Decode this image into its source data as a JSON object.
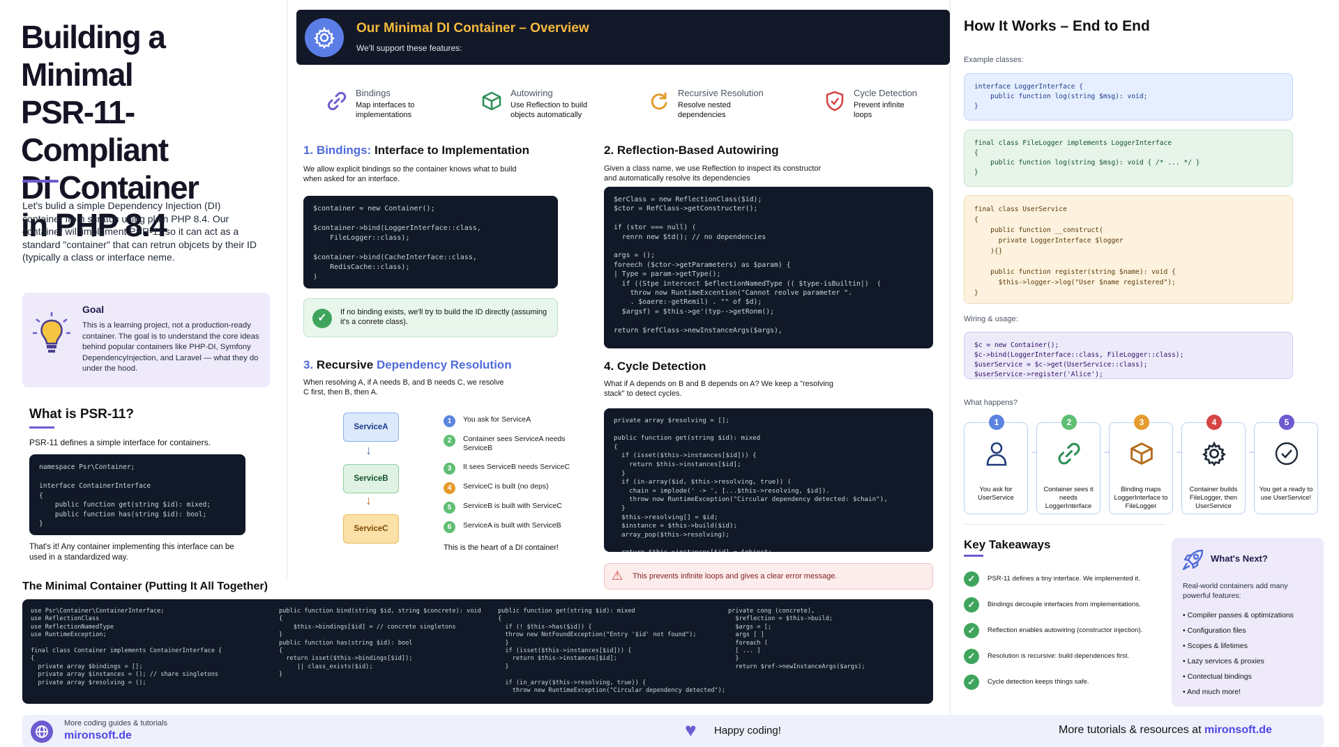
{
  "left": {
    "title_lines": [
      "Building a Minimal",
      "PSR-11-Compliant",
      "DI Container",
      "in PHP 8.4"
    ],
    "intro": "Let's bulid a simple Dependency Injection (DI) container from scratch using plain PHP 8.4. Our container will implement PSR-11 so it can act as a standard \"container\" that can retrun objcets by their ID (typically a class or interface neme.",
    "goal_title": "Goal",
    "goal_text": "This is a learning project, not a production-ready container. The goal is to understand the core ideas behind popular containers like PHP-DI, Symfony DependencyInjection, and Laravel — what they do under the hood.",
    "psr_title": "What is PSR-11?",
    "psr_text": "PSR-11 defines a simple interface for containers.",
    "psr_code": "namespace Psr\\Container;\n\ninterface ContainerInterface\n{\n    public function get(string $id): mixed;\n    public function has(string $id): bool;\n}",
    "psr_footer": "That's it! Any container implementing this interface can be used in a standardized way."
  },
  "overview": {
    "title": "Our Minimal DI Container – Overview",
    "subtitle": "We'll support these features:",
    "features": [
      {
        "name": "Bindings",
        "desc": "Map interfaces to implementations",
        "icon": "link-icon"
      },
      {
        "name": "Autowiring",
        "desc": "Use Reflection to build objects automatically",
        "icon": "cube-icon"
      },
      {
        "name": "Recursive Resolution",
        "desc": "Resolve nested dependencies",
        "icon": "refresh-icon"
      },
      {
        "name": "Cycle Detection",
        "desc": "Prevent infinite loops",
        "icon": "shield-icon"
      }
    ]
  },
  "s1": {
    "num": "1.",
    "hl": "Bindings:",
    "title": "Interface to Implementation",
    "desc": "We allow explicit bindings so the container knows what to build when asked for an interface.",
    "code": "$container = new Container();\n\n$container->bind(LoggerInterface::class,\n    FileLogger::class);\n\n$container->bind(CacheInterface::class,\n    RedisCache::class);\n)",
    "note": "If no binding exists, we'll try to build the ID directly (assuming it's a conrete class)."
  },
  "s2": {
    "title": "2. Reflection-Based Autowiring",
    "desc": "Given a class name, we use Reflection to inspect its constructor and automatically resolve its dependencies",
    "code": "$erClass = new ReflectionClass($id);\n$ctor = RefClass->getConstructer();\n\nif (stor === null) (\n  renrn new $td(); // no dependencies\n\nargs = ();\nforeech ($ctor->getParameters) as $param) {\n| Type = param->getType();\n  if ((Stpe intercect $eflectionNamedType (( $type-isBuiltin|)  (\n    throw now RuntimeExcention(\"Cannot reolve parameter \".\n    . $oaere:-getRemil) . \"\" of $d);\n  $argsf) = $this->ge'(typ-->getRonm();\n\nreturn $refClass->newInstanceArgs($args),"
  },
  "s3": {
    "num": "3.",
    "title": "Recursive",
    "hl": "Dependency Resolution",
    "desc": "When resolving A, if A needs B, and B needs C, we resolve C first, then B, then A.",
    "nodes": [
      "ServiceA",
      "ServiceB",
      "ServiceC"
    ],
    "steps": [
      {
        "n": "1",
        "text": "You ask for ServiceA"
      },
      {
        "n": "2",
        "text": "Container sees ServiceA needs ServiceB"
      },
      {
        "n": "3",
        "text": "It sees ServiceB needs ServiceC"
      },
      {
        "n": "4",
        "text": "ServiceC is built (no deps)"
      },
      {
        "n": "5",
        "text": "ServiceB is built with ServiceC"
      },
      {
        "n": "6",
        "text": "ServiceA is built with ServiceB"
      }
    ],
    "footer": "This is the heart of a DI container!"
  },
  "s4": {
    "title": "4. Cycle Detection",
    "desc": "What if A depends on B and B depends on A? We keep a \"resolving stack\" to detect cycles.",
    "code": "private array $resolving = [];\n\npublic function get(string $id): mixed\n{\n  if (isset($this->instances[$id])) {\n    return $this->instances[$id];\n  }\n  if (in-array($id, $this->resolving, true)) (\n    chain = implode(' -> ', [...$this->resolving, $id]).\n    throw now RuntimeException(\"Circular dependency detected: $chain\"),\n  }\n  $this->resolving[] = $id;\n  $instance = $this->build($id);\n  array_pop($this->resolving);\n\n  return $this->instances[$id] = $object;",
    "warn": "This prevents infinite loops and gives a clear error message."
  },
  "minimal": {
    "title": "The Minimal Container (Putting It All Together)",
    "col1": "use Psr\\Container\\ContainerInterface;\nuse ReflectionClass\nuse ReflectionNamedType\nuse RuntimeException;\n\nfinal class Container implements ContainerInterface {\n{\n  private array $bindings = [];\n  private array $instances = (); // share singletons\n  private array $resolving = ();",
    "col2": "public function bind(string $id, string $concrete): void\n{\n    $this->bindings[$id] = // concrete singletons\n}\npublic function has(string $id): bool\n{\n  return isset($this->bindings[$id]);\n     || class_exists($id);\n}",
    "col3": "public function get(string $id): mixed\n{\n  if (! $this->has($id)) {\n  throw new NotFoundException(\"Entry '$id' not found\");\n  }\n  if (isset($this->instances[$id])) {\n    return $this->instances[$id];\n  }\n\n  if (in_array($this->resolving, true)) {\n    throw new RuntimeException(\"Circular dependency detected\");",
    "col4": "private cong (concrete),\n  $reflection = $this->build;\n  $args = [;\n  args [ ]\n  foreach (\n  [ ... ]\n  }\n  return $ref->newInstanceArgs($args);"
  },
  "right": {
    "title": "How It Works – End to End",
    "classes_label": "Example classes:",
    "code1": "interface LoggerInterface {\n    public function log(string $msg): void;\n}",
    "code2": "final class FileLogger implements LoggerInterface\n{\n    public function log(string $msg): void { /* ... */ }\n}",
    "code3": "final class UserService\n{\n    public function __construct(\n      private LoggerInterface $logger\n    ){}\n\n    public function register(string $name): void {\n      $this->logger->log(\"User $name registered\");\n}",
    "wiring_label": "Wiring & usage:",
    "code4": "$c = new Container();\n$c->bind(LoggerInterface::class, FileLogger::class);\n$userService = $c->get(UserService::class);\n$userService->register('Alice');",
    "happens_label": "What happens?",
    "flow": [
      {
        "n": "1",
        "text": "You ask for UserService",
        "icon": "user-icon"
      },
      {
        "n": "2",
        "text": "Container sees it needs LoggerInterface",
        "icon": "link-icon"
      },
      {
        "n": "3",
        "text": "Binding maps LoggerInterface to FileLogger",
        "icon": "cube-icon"
      },
      {
        "n": "4",
        "text": "Container builds FileLogger, then UserService",
        "icon": "gear-icon"
      },
      {
        "n": "5",
        "text": "You get a ready to use UserService!",
        "icon": "check-icon"
      }
    ],
    "takeaways_title": "Key Takeaways",
    "takeaways": [
      "PSR-11 defines a tiny interface. We implemented it.",
      "Bindings decouple interfaces from implementations.",
      "Reflection enables autowiring (constructor injection).",
      "Resolution is recursive: build dependences first.",
      "Cycle detection keeps things safe."
    ],
    "next_title": "What's Next?",
    "next_desc": "Real-world containers add many powerful features:",
    "next_items": [
      "Compiler passes & optimizations",
      "Configuration files",
      "Scopes & lifetimes",
      "Lazy services & proxies",
      "Contectual bindings",
      "And much more!"
    ]
  },
  "footer": {
    "left_small": "More coding guides & tutorials",
    "left_link": "mironsoft.de",
    "center": "Happy coding!",
    "right_text": "More tutorials & resources at",
    "right_link": "mironsoft.de"
  },
  "colors": {
    "accent": "#6d5bd0",
    "blue": "#4f6bd8",
    "orange": "#e49b2f",
    "green": "#3fa55c",
    "red": "#d64545",
    "dark": "#111827"
  }
}
